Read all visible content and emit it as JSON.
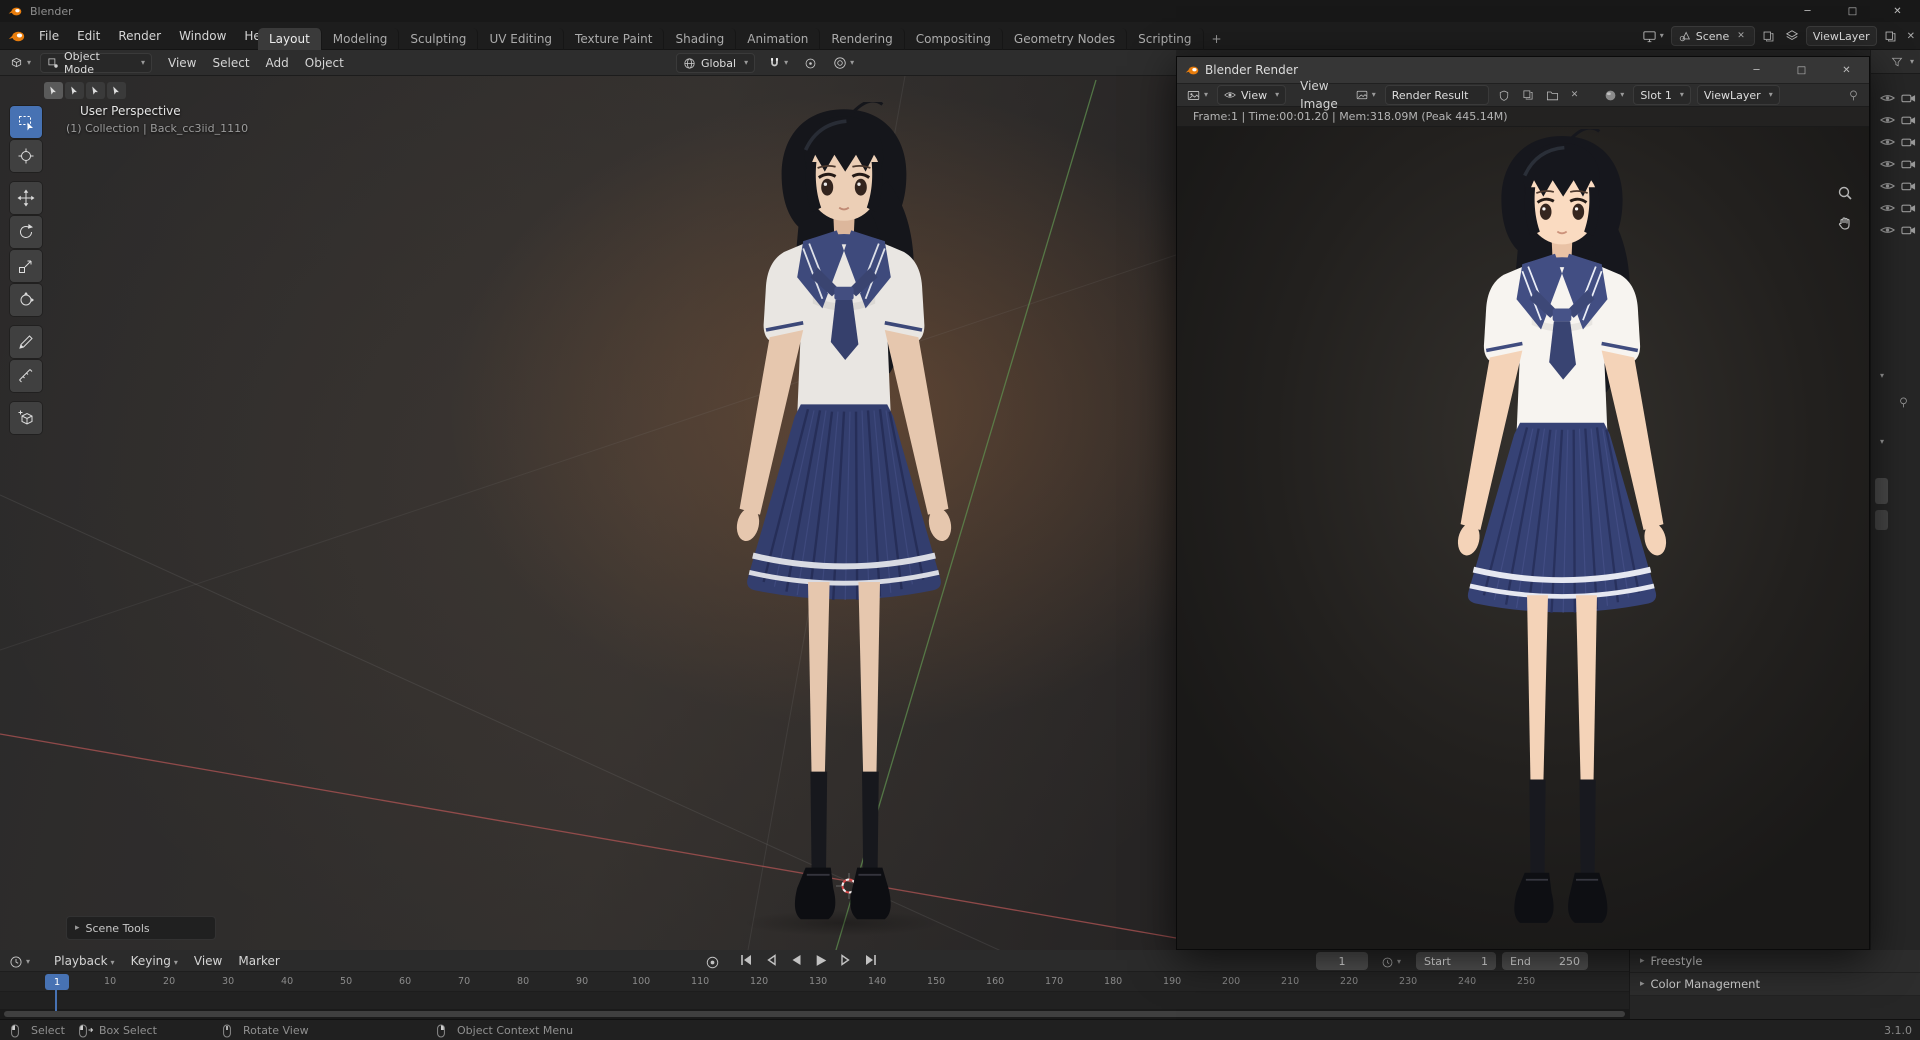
{
  "glyphs": {
    "minimize": "─",
    "maximize": "□",
    "close": "✕",
    "chevron": "▾",
    "collapsed_arrow": "▸"
  },
  "window": {
    "title": "Blender"
  },
  "topbar": {
    "menus": [
      "File",
      "Edit",
      "Render",
      "Window",
      "Help"
    ],
    "workspaces": [
      "Layout",
      "Modeling",
      "Sculpting",
      "UV Editing",
      "Texture Paint",
      "Shading",
      "Animation",
      "Rendering",
      "Compositing",
      "Geometry Nodes",
      "Scripting"
    ],
    "active_workspace": "Layout",
    "add_tab": "+",
    "scene": "Scene",
    "view_layer": "ViewLayer"
  },
  "viewport": {
    "mode": "Object Mode",
    "menus": [
      "View",
      "Select",
      "Add",
      "Object"
    ],
    "orientation": "Global",
    "overlay_title": "User Perspective",
    "overlay_subtitle": "(1) Collection | Back_cc3iid_1110",
    "scene_tools_label": "Scene Tools"
  },
  "render_window": {
    "title": "Blender Render",
    "mode": "View",
    "menus": [
      "View",
      "Image"
    ],
    "datablock": "Render Result",
    "slot": "Slot 1",
    "view_layer": "ViewLayer",
    "stats": "Frame:1 | Time:00:01.20 | Mem:318.09M (Peak 445.14M)"
  },
  "properties": {
    "panels": [
      "Freestyle",
      "Color Management"
    ]
  },
  "timeline": {
    "menus": [
      "Playback",
      "Keying",
      "View",
      "Marker"
    ],
    "current_frame": "1",
    "start_label": "Start",
    "start": "1",
    "end_label": "End",
    "end": "250",
    "ruler_frames": [
      1,
      10,
      20,
      30,
      40,
      50,
      60,
      70,
      80,
      90,
      100,
      110,
      120,
      130,
      140,
      150,
      160,
      170,
      180,
      190,
      200,
      210,
      220,
      230,
      240,
      250
    ]
  },
  "statusbar": {
    "hints": [
      "Select",
      "Box Select",
      "Rotate View",
      "Object Context Menu"
    ],
    "version": "3.1.0"
  }
}
